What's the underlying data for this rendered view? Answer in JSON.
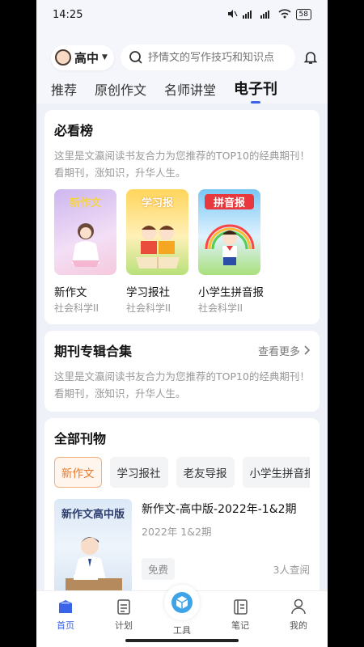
{
  "status": {
    "time": "14:25",
    "network": "&#8201;",
    "battery": "58"
  },
  "header": {
    "grade": "高中",
    "search_placeholder": "抒情文的写作技巧和知识点"
  },
  "tabs": [
    {
      "label": "推荐"
    },
    {
      "label": "原创作文"
    },
    {
      "label": "名师讲堂"
    },
    {
      "label": "电子刊"
    }
  ],
  "must_read": {
    "title": "必看榜",
    "desc": "这里是文瀛阅读书友合力为您推荐的TOP10的经典期刊！看期刊，涨知识，升华人生。",
    "items": [
      {
        "cover_text": "新作文",
        "name": "新作文",
        "category": "社会科学II",
        "color": "#d9c6f0"
      },
      {
        "cover_text": "学习报",
        "name": "学习报社",
        "category": "社会科学II",
        "color": "#ffd66b"
      },
      {
        "cover_text": "拼音报",
        "name": "小学生拼音报",
        "category": "社会科学II",
        "color": "#7fc8f5"
      }
    ]
  },
  "collections": {
    "title": "期刊专辑合集",
    "more": "查看更多",
    "desc": "这里是文瀛阅读书友合力为您推荐的TOP10的经典期刊！看期刊，涨知识，升华人生。"
  },
  "all": {
    "title": "全部刊物",
    "chips": [
      "新作文",
      "学习报社",
      "老友导报",
      "小学生拼音报"
    ],
    "item": {
      "cover_text": "新作文高中版",
      "title": "新作文-高中版-2022年-1&2期",
      "subtitle": "2022年 1&2期",
      "badge": "免费",
      "views": "3人查阅"
    }
  },
  "nav": [
    {
      "label": "首页",
      "icon": "home-icon"
    },
    {
      "label": "计划",
      "icon": "plan-icon"
    },
    {
      "label": "工具",
      "icon": "tools-icon"
    },
    {
      "label": "笔记",
      "icon": "notes-icon"
    },
    {
      "label": "我的",
      "icon": "profile-icon"
    }
  ],
  "colors": {
    "accent": "#3a63e8",
    "chip_active": "#e8782b"
  }
}
